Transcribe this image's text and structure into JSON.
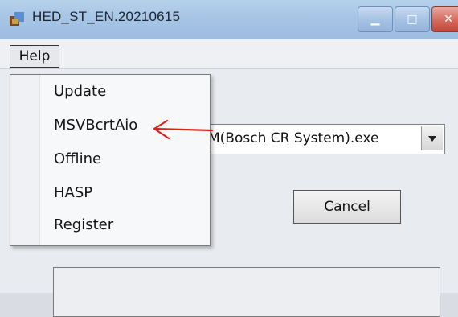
{
  "window": {
    "title": "HED_ST_EN.20210615",
    "controls": {
      "minimize": "minimize",
      "maximize": "maximize",
      "close": "close"
    }
  },
  "menubar": {
    "help_label": "Help"
  },
  "help_menu": {
    "items": [
      "Update",
      "MSVBcrtAio",
      "Offline",
      "HASP",
      "Register"
    ]
  },
  "main": {
    "combo_value": "M(Bosch CR System).exe",
    "cancel_label": "Cancel"
  },
  "annotation": {
    "color": "#e0201a"
  }
}
